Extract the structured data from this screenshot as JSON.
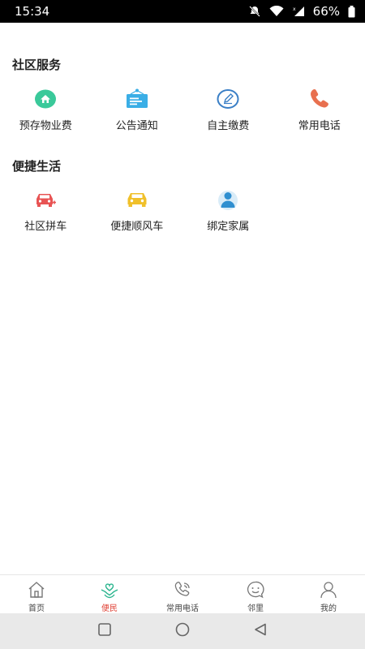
{
  "status_bar": {
    "time": "15:34",
    "battery": "66%"
  },
  "sections": {
    "community_service": {
      "title": "社区服务",
      "items": [
        {
          "label": "预存物业费",
          "icon": "home-icon",
          "color": "#3ac99a"
        },
        {
          "label": "公告通知",
          "icon": "notice-board-icon",
          "color": "#3aaee6"
        },
        {
          "label": "自主缴费",
          "icon": "edit-pen-icon",
          "color": "#3a7fc6"
        },
        {
          "label": "常用电话",
          "icon": "phone-icon",
          "color": "#e8704f"
        }
      ]
    },
    "convenient_life": {
      "title": "便捷生活",
      "items": [
        {
          "label": "社区拼车",
          "icon": "carpool-icon",
          "color": "#e85454"
        },
        {
          "label": "便捷顺风车",
          "icon": "car-icon",
          "color": "#f0c02a"
        },
        {
          "label": "绑定家属",
          "icon": "family-icon",
          "color": "#2f8fd0"
        }
      ]
    }
  },
  "tab_bar": {
    "active_color": "#e0463a",
    "tabs": [
      {
        "label": "首页",
        "icon": "home-outline-icon"
      },
      {
        "label": "便民",
        "icon": "heart-hand-icon",
        "active": true
      },
      {
        "label": "常用电话",
        "icon": "phone-outline-icon"
      },
      {
        "label": "邻里",
        "icon": "smile-icon"
      },
      {
        "label": "我的",
        "icon": "person-icon"
      }
    ]
  }
}
